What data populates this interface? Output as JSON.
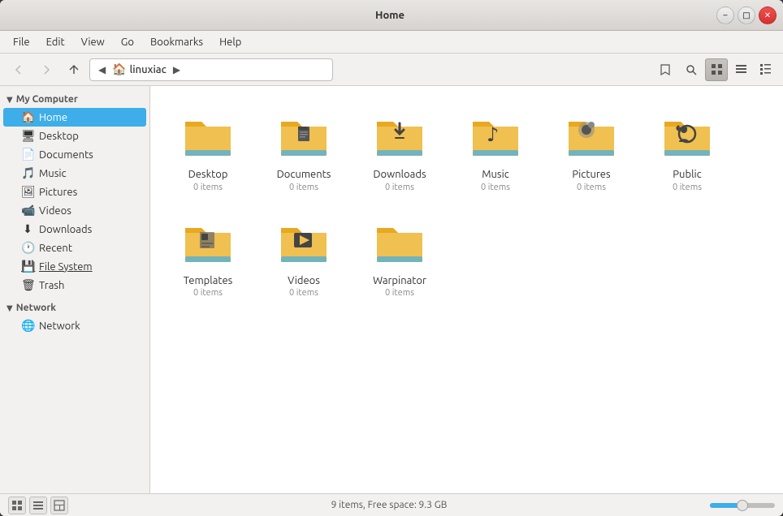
{
  "window": {
    "title": "Home",
    "controls": {
      "minimize": "–",
      "maximize": "□",
      "close": "✕"
    }
  },
  "menubar": {
    "items": [
      "File",
      "Edit",
      "View",
      "Go",
      "Bookmarks",
      "Help"
    ]
  },
  "toolbar": {
    "back_title": "Back",
    "forward_title": "Forward",
    "up_title": "Up",
    "location": "linuxiac",
    "search_title": "Search",
    "view_icons_title": "Icon View",
    "view_list_title": "List View",
    "view_compact_title": "Compact View"
  },
  "sidebar": {
    "my_computer_label": "My Computer",
    "items_computer": [
      {
        "id": "home",
        "label": "Home",
        "icon": "🏠"
      },
      {
        "id": "desktop",
        "label": "Desktop",
        "icon": "🖥"
      },
      {
        "id": "documents",
        "label": "Documents",
        "icon": "📄"
      },
      {
        "id": "music",
        "label": "Music",
        "icon": "🎵"
      },
      {
        "id": "pictures",
        "label": "Pictures",
        "icon": "🖼"
      },
      {
        "id": "videos",
        "label": "Videos",
        "icon": "📹"
      },
      {
        "id": "downloads",
        "label": "Downloads",
        "icon": "⬇"
      },
      {
        "id": "recent",
        "label": "Recent",
        "icon": "🕐"
      },
      {
        "id": "filesystem",
        "label": "File System",
        "icon": "💾"
      },
      {
        "id": "trash",
        "label": "Trash",
        "icon": "🗑"
      }
    ],
    "network_label": "Network",
    "items_network": [
      {
        "id": "network",
        "label": "Network",
        "icon": "🌐"
      }
    ]
  },
  "files": [
    {
      "id": "desktop",
      "name": "Desktop",
      "count": "0 items",
      "type": "plain"
    },
    {
      "id": "documents",
      "name": "Documents",
      "count": "0 items",
      "type": "doc"
    },
    {
      "id": "downloads",
      "name": "Downloads",
      "count": "0 items",
      "type": "download"
    },
    {
      "id": "music",
      "name": "Music",
      "count": "0 items",
      "type": "music"
    },
    {
      "id": "pictures",
      "name": "Pictures",
      "count": "0 items",
      "type": "pictures"
    },
    {
      "id": "public",
      "name": "Public",
      "count": "0 items",
      "type": "public"
    },
    {
      "id": "templates",
      "name": "Templates",
      "count": "0 items",
      "type": "templates"
    },
    {
      "id": "videos",
      "name": "Videos",
      "count": "0 items",
      "type": "videos"
    },
    {
      "id": "warpinator",
      "name": "Warpinator",
      "count": "0 items",
      "type": "plain"
    }
  ],
  "statusbar": {
    "text": "9 items, Free space: 9.3 GB"
  },
  "colors": {
    "folder_body": "#f0c050",
    "folder_tab": "#e8a820",
    "folder_stripe": "#3daee9",
    "accent": "#3daee9"
  }
}
